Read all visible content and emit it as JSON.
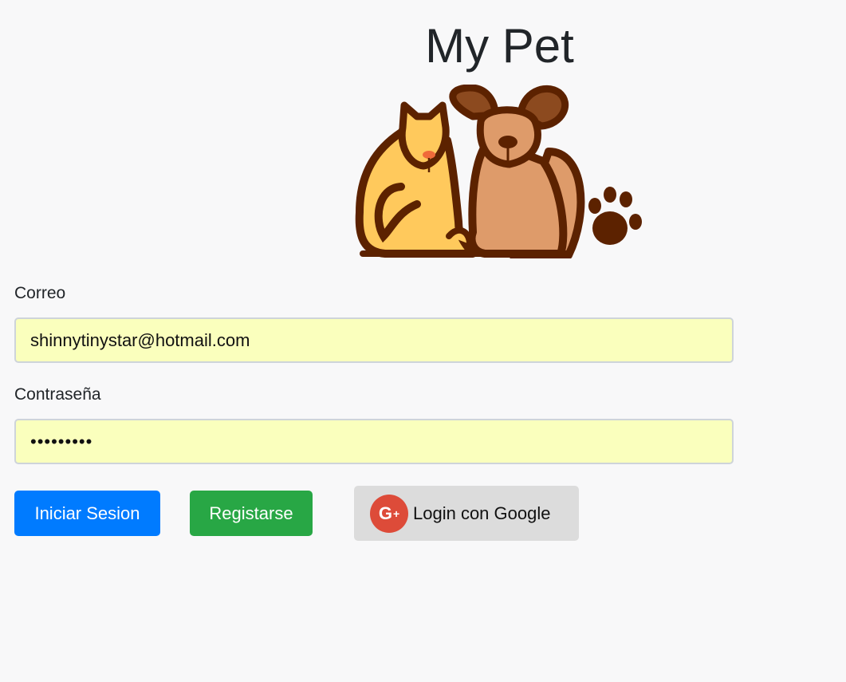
{
  "app": {
    "title": "My Pet"
  },
  "logo": {
    "icon": "cat-dog-paw-logo",
    "colors": {
      "outline": "#5c2200",
      "cat": "#ffc95c",
      "dog": "#de9b6a",
      "dog_ears": "#8c4a1f",
      "nose": "#f06a3a"
    }
  },
  "form": {
    "email_label": "Correo",
    "email_value": "shinnytinystar@hotmail.com",
    "password_label": "Contraseña",
    "password_value": "•••••••••"
  },
  "buttons": {
    "login_label": "Iniciar Sesion",
    "register_label": "Registarse",
    "google_label": "Login con Google",
    "google_icon": "google-plus-icon",
    "google_icon_text": "G",
    "colors": {
      "login": "#007bff",
      "register": "#28a745",
      "google": "#dcdcdc",
      "google_icon": "#dd4b39"
    }
  }
}
